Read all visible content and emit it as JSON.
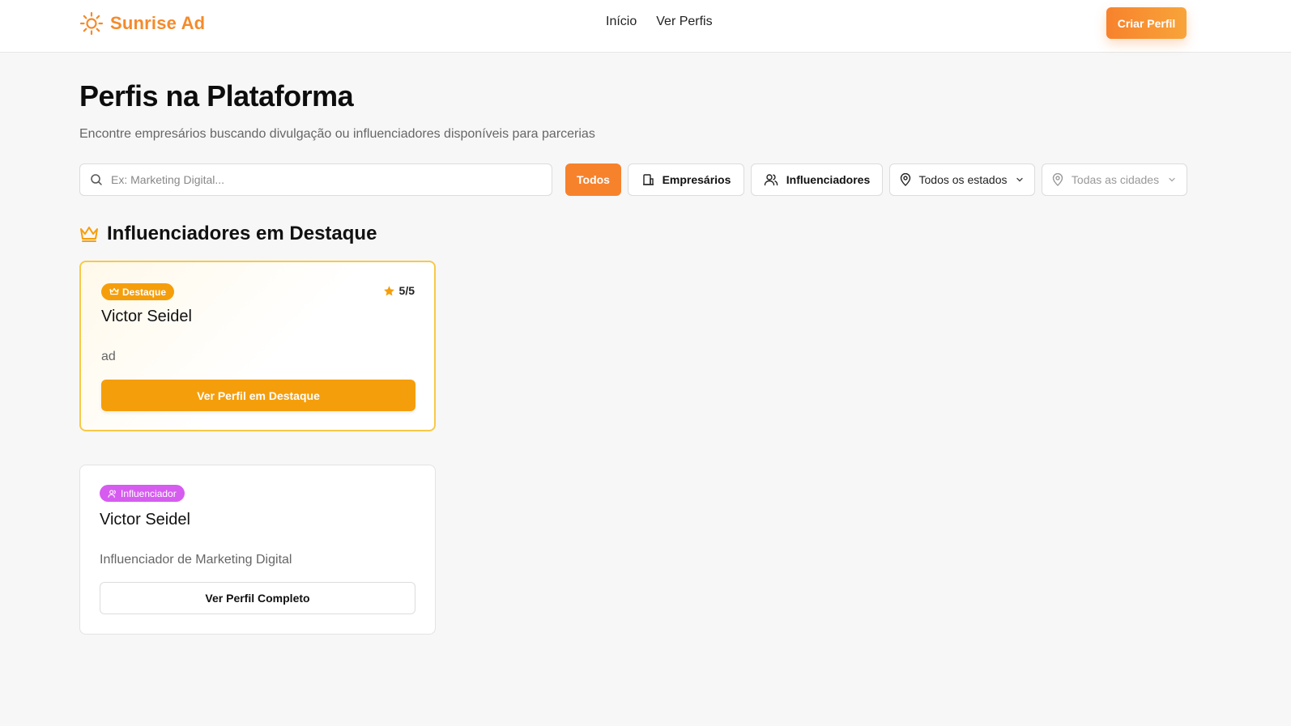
{
  "header": {
    "brand": "Sunrise Ad",
    "nav": [
      {
        "label": "Início"
      },
      {
        "label": "Ver Perfis"
      }
    ],
    "cta_label": "Criar Perfil"
  },
  "page": {
    "title": "Perfis na Plataforma",
    "subtitle": "Encontre empresários buscando divulgação ou influenciadores disponíveis para parcerias"
  },
  "filters": {
    "search_placeholder": "Ex: Marketing Digital...",
    "search_value": "",
    "buttons": [
      {
        "label": "Todos",
        "active": true
      },
      {
        "label": "Empresários",
        "icon": "building-icon"
      },
      {
        "label": "Influenciadores",
        "icon": "users-icon"
      }
    ],
    "state_select": {
      "value": "Todos os estados",
      "icon": "map-pin-icon"
    },
    "city_select": {
      "value": "Todas as cidades",
      "icon": "map-pin-icon",
      "disabled": true
    }
  },
  "featured_section": {
    "title": "Influenciadores em Destaque",
    "icon": "crown-icon"
  },
  "featured_card": {
    "badge": "Destaque",
    "badge_icon": "crown-icon",
    "rating": "5/5",
    "rating_icon": "star-icon",
    "name": "Victor Seidel",
    "description": "ad",
    "button_label": "Ver Perfil em Destaque"
  },
  "profile_card": {
    "badge": "Influenciador",
    "badge_icon": "user-icon",
    "name": "Victor Seidel",
    "description": "Influenciador de Marketing Digital",
    "button_label": "Ver Perfil Completo"
  },
  "colors": {
    "brand_orange": "#f7822c",
    "featured_gold": "#f59e0b",
    "influencer_purple": "#d65cf0"
  }
}
